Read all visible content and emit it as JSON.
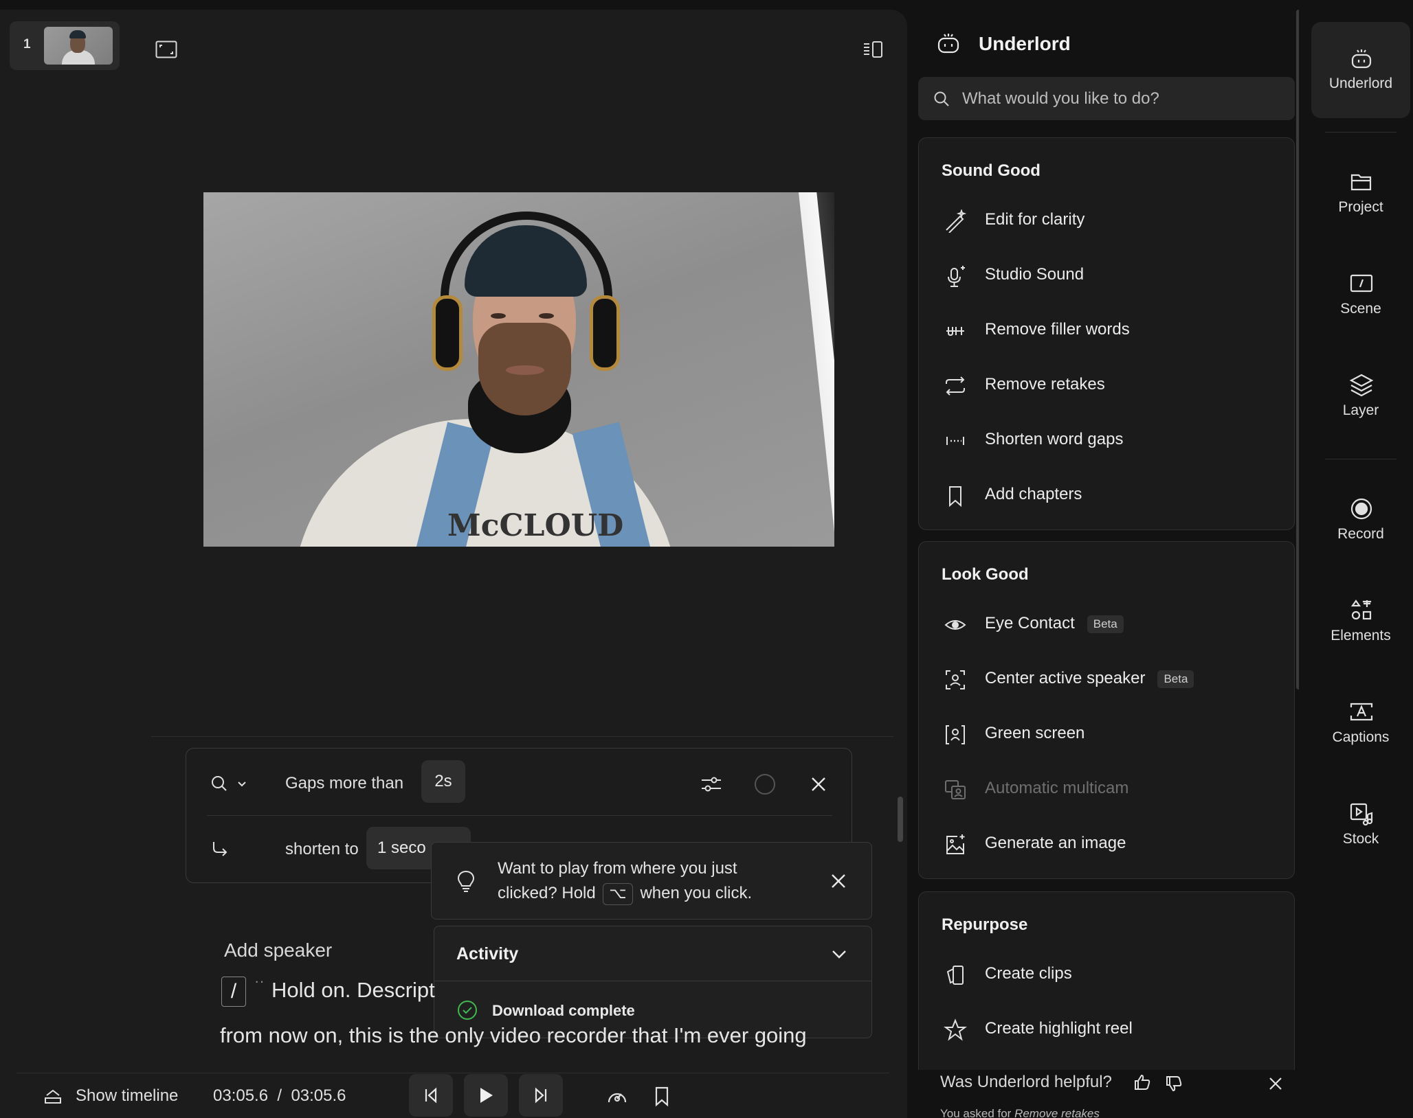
{
  "editor": {
    "scene_number": "1",
    "gap_filter": {
      "label": "Gaps more than",
      "value": "2s",
      "shorten_label": "shorten to",
      "shorten_value": "1 seco"
    },
    "tip": {
      "line1": "Want to play from where you just",
      "line2_pre": "clicked? Hold",
      "key": "⌥",
      "line2_post": "when you click."
    },
    "activity": {
      "title": "Activity",
      "item": "Download complete"
    },
    "transcript": {
      "add_speaker": "Add speaker",
      "slash": "/",
      "line1": "Hold on. Descript",
      "line2": "from now on, this is the only video recorder that I'm ever going"
    },
    "bottom": {
      "show_timeline": "Show timeline",
      "current_time": "03:05.6",
      "separator": "/",
      "total_time": "03:05.6"
    },
    "video": {
      "shirt_text": "McCLOUD"
    }
  },
  "side": {
    "title": "Underlord",
    "search_placeholder": "What would you like to do?",
    "sound_good": {
      "title": "Sound Good",
      "items": [
        {
          "label": "Edit for clarity",
          "icon": "wand-icon"
        },
        {
          "label": "Studio Sound",
          "icon": "microphone-sparkle-icon"
        },
        {
          "label": "Remove filler words",
          "icon": "filler-words-icon"
        },
        {
          "label": "Remove retakes",
          "icon": "retake-arrows-icon"
        },
        {
          "label": "Shorten word gaps",
          "icon": "word-gaps-icon"
        },
        {
          "label": "Add chapters",
          "icon": "bookmark-icon"
        }
      ]
    },
    "look_good": {
      "title": "Look Good",
      "items": [
        {
          "label": "Eye Contact",
          "badge": "Beta",
          "icon": "eye-icon"
        },
        {
          "label": "Center active speaker",
          "badge": "Beta",
          "icon": "center-speaker-icon"
        },
        {
          "label": "Green screen",
          "icon": "green-screen-icon"
        },
        {
          "label": "Automatic multicam",
          "icon": "multicam-icon",
          "disabled": true
        },
        {
          "label": "Generate an image",
          "icon": "generate-image-icon"
        }
      ]
    },
    "repurpose": {
      "title": "Repurpose",
      "items": [
        {
          "label": "Create clips",
          "icon": "clips-icon"
        },
        {
          "label": "Create highlight reel",
          "icon": "star-icon"
        }
      ]
    },
    "feedback": {
      "question": "Was Underlord helpful?",
      "asked_prefix": "You asked for",
      "asked_value": "Remove retakes"
    }
  },
  "rail": {
    "items": [
      {
        "label": "Underlord",
        "active": true
      },
      {
        "label": "Project"
      },
      {
        "label": "Scene"
      },
      {
        "label": "Layer"
      },
      {
        "label": "Record"
      },
      {
        "label": "Elements"
      },
      {
        "label": "Captions"
      },
      {
        "label": "Stock"
      }
    ]
  },
  "colors": {
    "background": "#121212",
    "panel": "#1c1c1c",
    "card": "#1b1b1b",
    "success": "#3fb950"
  }
}
